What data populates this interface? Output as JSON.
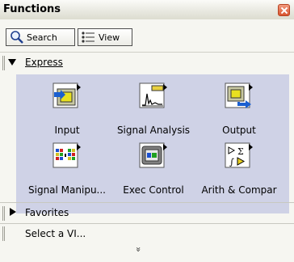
{
  "window": {
    "title": "Functions"
  },
  "toolbar": {
    "search_label": "Search",
    "view_label": "View"
  },
  "express": {
    "label": "Express",
    "items": [
      {
        "label": "Input",
        "icon": "input-vi-icon"
      },
      {
        "label": "Signal Analysis",
        "icon": "signal-analysis-icon"
      },
      {
        "label": "Output",
        "icon": "output-vi-icon"
      },
      {
        "label": "Signal Manipu...",
        "icon": "signal-manipulation-icon"
      },
      {
        "label": "Exec Control",
        "icon": "exec-control-icon"
      },
      {
        "label": "Arith & Compar",
        "icon": "arith-compare-icon"
      }
    ]
  },
  "favorites": {
    "label": "Favorites"
  },
  "select_vi": {
    "label": "Select a VI..."
  },
  "colors": {
    "palette_bg": "#cfd2e6",
    "close_button": "#d8542f"
  }
}
